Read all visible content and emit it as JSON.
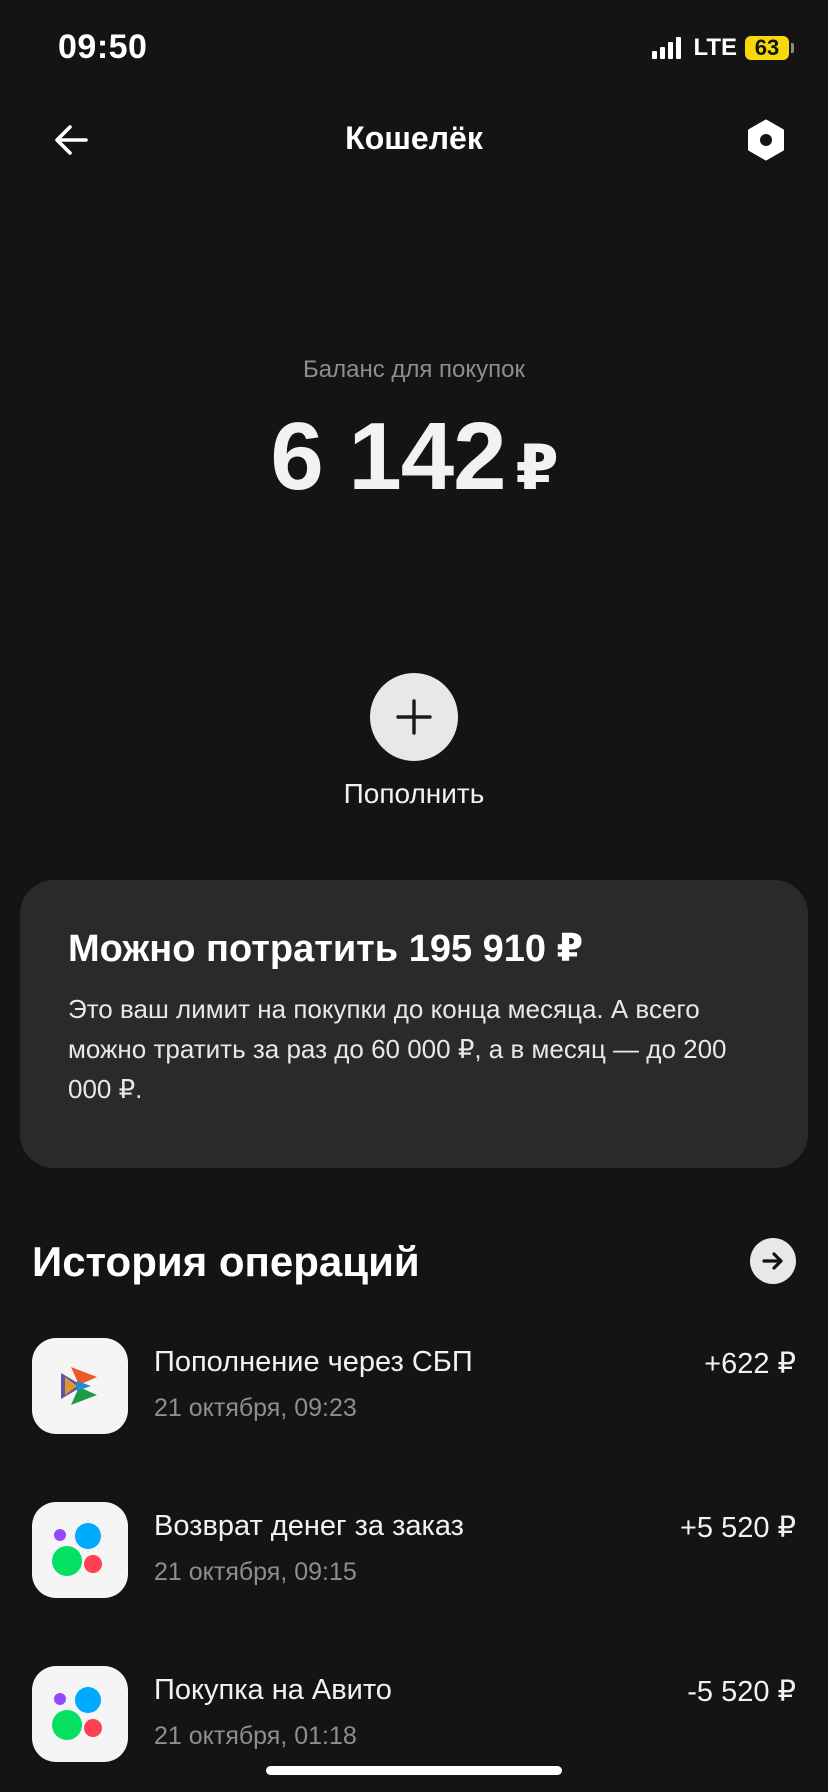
{
  "status": {
    "time": "09:50",
    "network": "LTE",
    "battery": "63"
  },
  "header": {
    "title": "Кошелёк"
  },
  "balance": {
    "label": "Баланс для покупок",
    "amount": "6 142",
    "currency": "₽"
  },
  "topup": {
    "label": "Пополнить"
  },
  "limit_card": {
    "title": "Можно потратить 195 910 ₽",
    "description": "Это ваш лимит на покупки до конца месяца. А всего можно тратить за раз до 60 000 ₽, а в месяц — до 200 000 ₽."
  },
  "history": {
    "title": "История операций",
    "items": [
      {
        "title": "Пополнение через СБП",
        "date": "21 октября, 09:23",
        "amount": "+622 ₽",
        "icon": "sbp-logo-icon"
      },
      {
        "title": "Возврат денег за заказ",
        "date": "21 октября, 09:15",
        "amount": "+5 520 ₽",
        "icon": "avito-logo-icon"
      },
      {
        "title": "Покупка на Авито",
        "date": "21 октября, 01:18",
        "amount": "-5 520 ₽",
        "icon": "avito-logo-icon"
      }
    ]
  },
  "colors": {
    "background": "#141414",
    "card": "#2a2a2a",
    "muted_text": "#8e8e8e",
    "battery": "#f5d90a"
  }
}
